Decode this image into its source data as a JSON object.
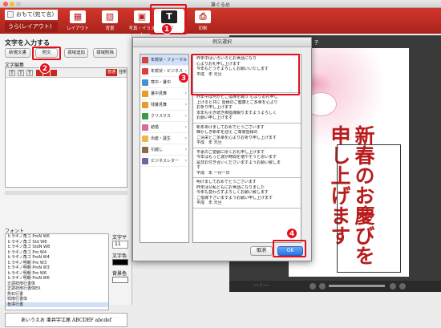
{
  "window": {
    "title": "筆ぐるめ"
  },
  "mode_tabs": {
    "front": "おもて(宛て名)",
    "back": "うら(レイアウト)"
  },
  "toolbar": {
    "items": [
      {
        "label": "レイアウト",
        "icon": "layout-icon"
      },
      {
        "label": "背景",
        "icon": "background-icon"
      },
      {
        "label": "写真・イラスト",
        "icon": "photo-illustration-icon"
      },
      {
        "label": "文字",
        "icon": "text-icon"
      },
      {
        "label": "印刷",
        "icon": "printer-icon"
      }
    ]
  },
  "left_panel": {
    "heading": "文字を入力する",
    "buttons": {
      "new": "新規文書",
      "sample": "例文",
      "add_area": "領域追加",
      "delete_area": "領域削除"
    },
    "edit_label": "文字編集",
    "edit_buttons": [
      "普通",
      "住所"
    ],
    "font_label": "フォント",
    "fonts": [
      "ヒラギノ角ゴ ProN W6",
      "ヒラギノ角ゴ Std W8",
      "ヒラギノ角ゴ StdN W8",
      "ヒラギノ角ゴ Pro W4",
      "ヒラギノ角ゴ ProN W4",
      "ヒラギノ明朝 Pro W3",
      "ヒラギノ明朝 ProN W3",
      "ヒラギノ明朝 Pro W6",
      "ヒラギノ明朝 ProN W6",
      "正調祥南行書体",
      "正調祥南行書体EX",
      "魚石行書",
      "祥南行書体",
      "有澤行書"
    ],
    "size_label": "文字サ",
    "size_value": "11",
    "color_label": "文字色",
    "bg_label": "背景色",
    "font_preview": "あいうえお 亜井宇江尾 ABCDEF abcdef"
  },
  "preview": {
    "card_title": "新春のお慶び01 子",
    "nav_readout": "---- / ----",
    "greeting": "新春のお慶びを申し上げます"
  },
  "dialog": {
    "title": "例文選択",
    "categories": [
      {
        "label": "年賀状・フォーマル",
        "color": "#d8423a"
      },
      {
        "label": "年賀状・ビジネス",
        "color": "#d8423a"
      },
      {
        "label": "寒中・暑中",
        "color": "#4a90d0"
      },
      {
        "label": "暑中見舞",
        "color": "#e89a2a"
      },
      {
        "label": "残暑見舞",
        "color": "#e89a2a"
      },
      {
        "label": "クリスマス",
        "color": "#3a9a4a"
      },
      {
        "label": "結婚",
        "color": "#d86aa0"
      },
      {
        "label": "出産・誕生",
        "color": "#e8b84a"
      },
      {
        "label": "引越し",
        "color": "#8a6a4a"
      },
      {
        "label": "ビジネスレター",
        "color": "#6a6a9a"
      }
    ],
    "samples": [
      [
        "昨年中はいろいろとお世話になり",
        "心よりお礼申し上げます",
        "今年もどうぞよろしくお願いいたします",
        "平成　年 元旦"
      ],
      [
        "昨年中は何かとご指導を賜り 心よりお礼申し",
        "上げると共に 皆様のご健康とご多幸を心より",
        "お祈り申し上げます",
        "本年も引き続き御指導賜りますようよろしく",
        "お願い申し上げます"
      ],
      [
        "新年あけましておめでとうございます",
        "輝かしき新年を迎え ご尊家皆様の",
        "ご清栄とご多幸を心よりお祈り申し上げます",
        "平成　年 元旦"
      ],
      [
        "平素のご愛顧に厚くお礼申し上げます",
        "今年はもっと波が時間を増やそうと思います",
        "是非お付き合いくださいますようお願い致しま",
        "す",
        "平成　年 一月一日"
      ],
      [
        "明けましておめでとうございます",
        "昨年は公私ともにお世話になりました",
        "今年も変わらずよろしくお願い致します",
        "ご指導下さいますようお願い申し上げます",
        "平成　年 元旦"
      ]
    ],
    "cancel": "取消",
    "ok": "OK"
  },
  "annotations": [
    "1",
    "2",
    "3",
    "4"
  ],
  "accent_color": "#c8291f",
  "highlight_color": "#e0101e"
}
